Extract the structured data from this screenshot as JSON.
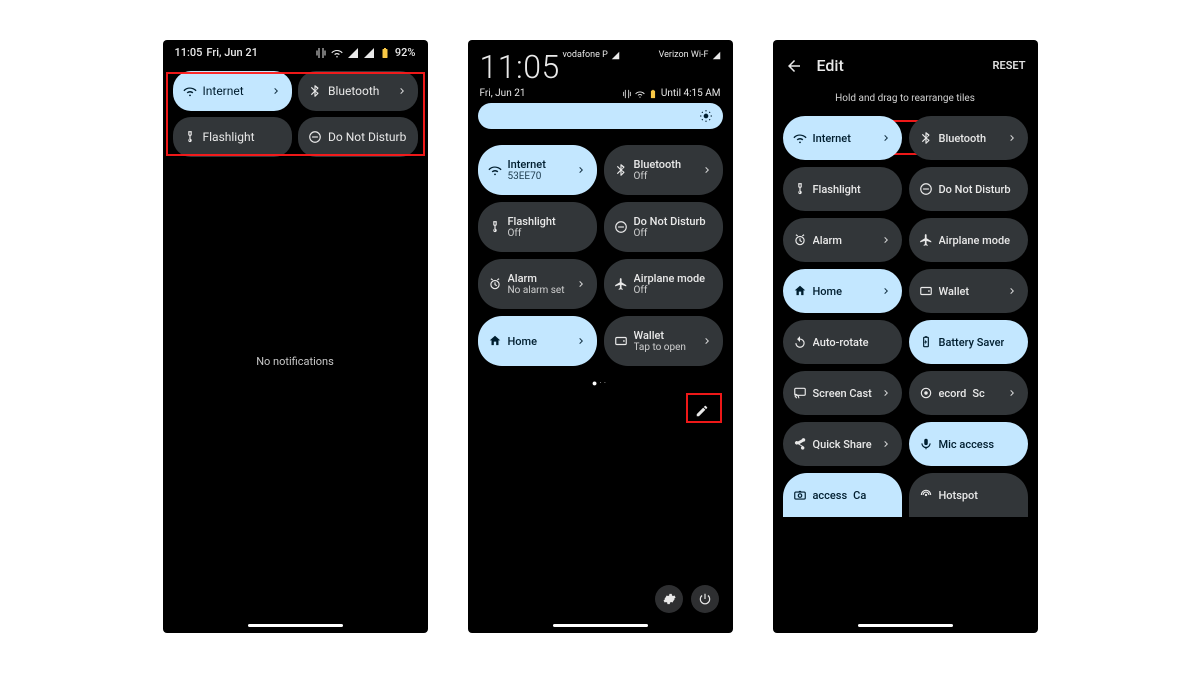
{
  "phone1": {
    "status": {
      "time": "11:05",
      "date": "Fri, Jun 21",
      "battery": "92%"
    },
    "tiles": {
      "internet": "Internet",
      "bluetooth": "Bluetooth",
      "flashlight": "Flashlight",
      "dnd": "Do Not Disturb"
    },
    "no_notifications": "No notifications"
  },
  "phone2": {
    "time": "11:05",
    "date": "Fri, Jun 21",
    "carrier_a": "vodafone P",
    "carrier_b": "Verizon Wi-F",
    "until": "Until 4:15 AM",
    "tiles": {
      "internet": {
        "title": "Internet",
        "sub": "53EE70"
      },
      "bluetooth": {
        "title": "Bluetooth",
        "sub": "Off"
      },
      "flashlight": {
        "title": "Flashlight",
        "sub": "Off"
      },
      "dnd": {
        "title": "Do Not Disturb",
        "sub": "Off"
      },
      "alarm": {
        "title": "Alarm",
        "sub": "No alarm set"
      },
      "airplane": {
        "title": "Airplane mode",
        "sub": "Off"
      },
      "home": {
        "title": "Home"
      },
      "wallet": {
        "title": "Wallet",
        "sub": "Tap to open"
      }
    }
  },
  "phone3": {
    "title": "Edit",
    "reset": "RESET",
    "instruction": "Hold and drag to rearrange tiles",
    "tiles": {
      "internet": "Internet",
      "bluetooth": "Bluetooth",
      "flashlight": "Flashlight",
      "dnd": "Do Not Disturb",
      "alarm": "Alarm",
      "airplane": "Airplane mode",
      "home": "Home",
      "wallet": "Wallet",
      "autorotate": "Auto-rotate",
      "battery": "Battery Saver",
      "screencast": "Screen Cast",
      "record": "ecord",
      "record2": "Sc",
      "quickshare": "Quick Share",
      "mic": "Mic access",
      "access": "access",
      "access2": "Ca",
      "hotspot": "Hotspot"
    }
  }
}
